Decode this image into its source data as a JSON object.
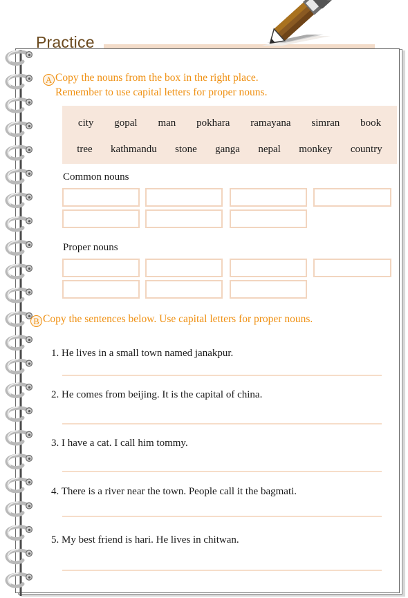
{
  "header": {
    "title": "Practice",
    "pencil_icon": "pencil-icon",
    "rule_color": "#f3dcc9",
    "title_color": "#6b4a1f"
  },
  "theme": {
    "accent_orange": "#ef9012",
    "box_border": "#f2d5bf",
    "bank_background": "#f7e7dc",
    "line_color": "#f6ddc9",
    "text_color": "#1a1a1a"
  },
  "exercises": [
    {
      "marker": "A",
      "lines": [
        "Copy the nouns from the box in the right place.",
        "Remember to use capital letters for proper nouns."
      ]
    },
    {
      "marker": "B",
      "lines": [
        "Copy the sentences below. Use capital letters for proper nouns."
      ]
    }
  ],
  "word_bank": {
    "row1": [
      "city",
      "gopal",
      "man",
      "pokhara",
      "ramayana",
      "simran",
      "book"
    ],
    "row2": [
      "tree",
      "kathmandu",
      "stone",
      "ganga",
      "nepal",
      "monkey",
      "country"
    ]
  },
  "answer_sections": [
    {
      "label": "Common nouns",
      "row1_boxes": 4,
      "row2_boxes": 3
    },
    {
      "label": "Proper nouns",
      "row1_boxes": 4,
      "row2_boxes": 3
    }
  ],
  "sentences": [
    {
      "number": "1.",
      "text": "He lives in a small town named janakpur."
    },
    {
      "number": "2.",
      "text": "He comes from beijing. It is the capital of china."
    },
    {
      "number": "3.",
      "text": "I have a cat. I call him tommy."
    },
    {
      "number": "4.",
      "text": "There is a river near the town. People call it the bagmati."
    },
    {
      "number": "5.",
      "text": "My best friend is hari. He lives in chitwan."
    }
  ],
  "spiral": {
    "coil_count": 23,
    "icon": "spiral-binding-coil"
  }
}
